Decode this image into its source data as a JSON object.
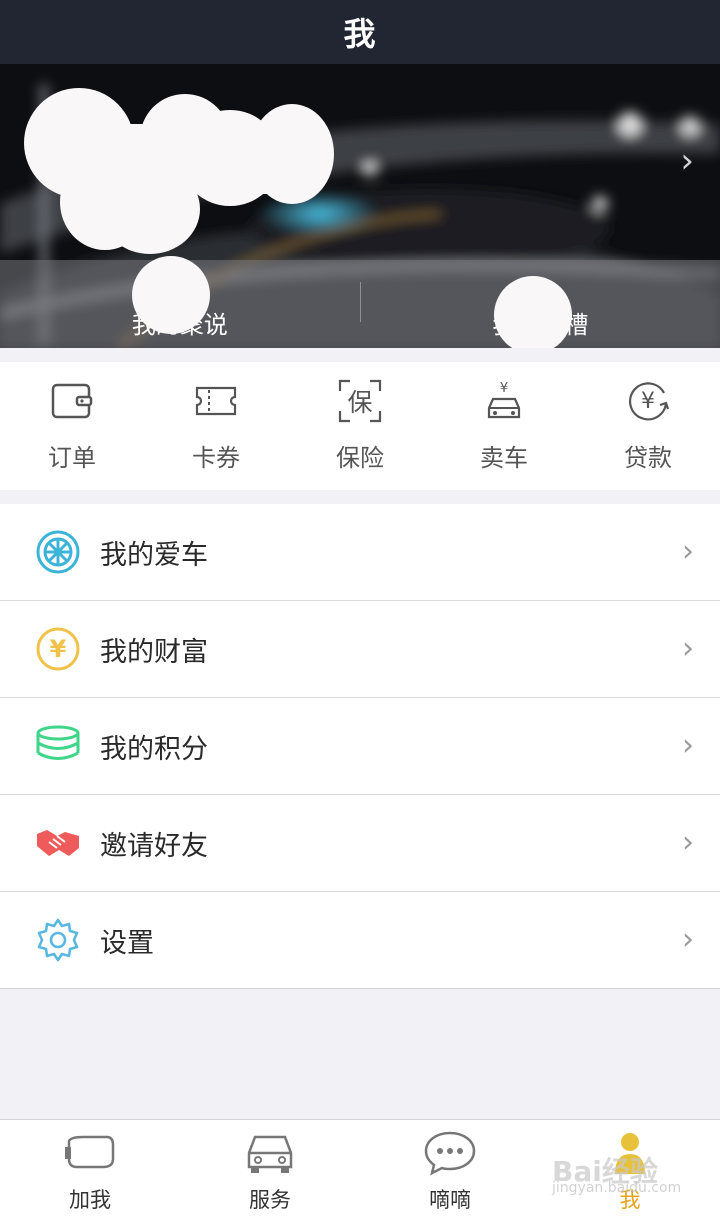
{
  "header": {
    "title": "我"
  },
  "hero": {
    "tabs": [
      {
        "label": "我的聚说"
      },
      {
        "label": "我要吐槽"
      }
    ]
  },
  "quick_actions": [
    {
      "label": "订单",
      "icon": "wallet-icon"
    },
    {
      "label": "卡券",
      "icon": "ticket-icon"
    },
    {
      "label": "保险",
      "icon": "insurance-icon",
      "glyph": "保"
    },
    {
      "label": "卖车",
      "icon": "sell-car-icon",
      "glyph": "¥"
    },
    {
      "label": "贷款",
      "icon": "loan-icon",
      "glyph": "¥"
    }
  ],
  "menu": [
    {
      "label": "我的爱车",
      "icon": "wheel-icon",
      "color": "#3bb4d8"
    },
    {
      "label": "我的财富",
      "icon": "coin-icon",
      "color": "#f0c24a",
      "glyph": "¥"
    },
    {
      "label": "我的积分",
      "icon": "points-stack-icon",
      "color": "#3fd68a"
    },
    {
      "label": "邀请好友",
      "icon": "handshake-icon",
      "color": "#ef5a5a"
    },
    {
      "label": "设置",
      "icon": "gear-icon",
      "color": "#5ab8e0"
    }
  ],
  "tabbar": [
    {
      "label": "加我",
      "icon": "mirror-icon"
    },
    {
      "label": "服务",
      "icon": "car-icon"
    },
    {
      "label": "嘀嘀",
      "icon": "chat-icon"
    },
    {
      "label": "我",
      "icon": "person-icon",
      "active": true
    }
  ],
  "watermark": {
    "brand": "Bai经验",
    "url": "jingyan.baidu.com"
  },
  "colors": {
    "header_bg": "#222633",
    "accent": "#e3a51c"
  }
}
